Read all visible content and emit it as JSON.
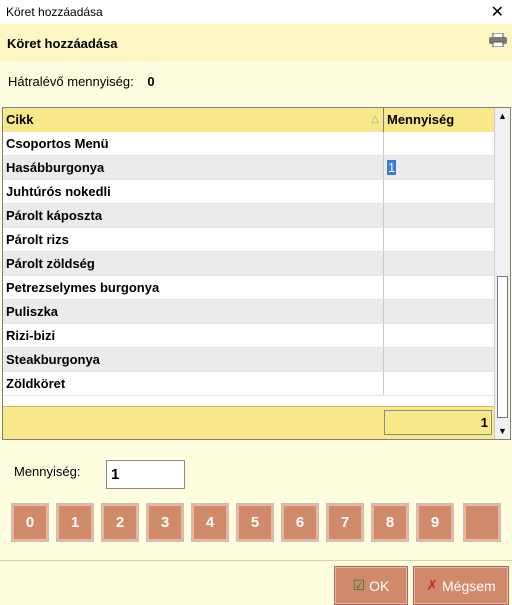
{
  "window": {
    "title": "Köret hozzáadása",
    "close_icon": "close-icon"
  },
  "header": {
    "title": "Köret hozzáadása",
    "print_icon": "printer-icon"
  },
  "remaining": {
    "label": "Hátralévő mennyiség:",
    "value": "0"
  },
  "grid": {
    "columns": [
      "Cikk",
      "Mennyiség"
    ],
    "sort_indicator": "△",
    "rows": [
      {
        "item": "Csoportos Menü",
        "qty": ""
      },
      {
        "item": "Hasábburgonya",
        "qty": "1"
      },
      {
        "item": "Juhtúrós nokedli",
        "qty": ""
      },
      {
        "item": "Párolt káposzta",
        "qty": ""
      },
      {
        "item": "Párolt rizs",
        "qty": ""
      },
      {
        "item": "Párolt zöldség",
        "qty": ""
      },
      {
        "item": "Petrezselymes burgonya",
        "qty": ""
      },
      {
        "item": "Puliszka",
        "qty": ""
      },
      {
        "item": "Rizi-bizi",
        "qty": ""
      },
      {
        "item": "Steakburgonya",
        "qty": ""
      },
      {
        "item": "Zöldköret",
        "qty": ""
      }
    ],
    "total": "1",
    "scroll_up": "▲",
    "scroll_down": "▼"
  },
  "quantity": {
    "label": "Mennyiség:",
    "value": "1"
  },
  "numpad": {
    "keys": [
      "0",
      "1",
      "2",
      "3",
      "4",
      "5",
      "6",
      "7",
      "8",
      "9",
      ""
    ]
  },
  "buttons": {
    "ok": {
      "label": "OK",
      "icon": "checkmark-icon"
    },
    "cancel": {
      "label": "Mégsem",
      "icon": "x-icon"
    }
  },
  "colors": {
    "accent": "#d18a69",
    "header_bg": "#f7e98a",
    "background": "#fffde0"
  }
}
